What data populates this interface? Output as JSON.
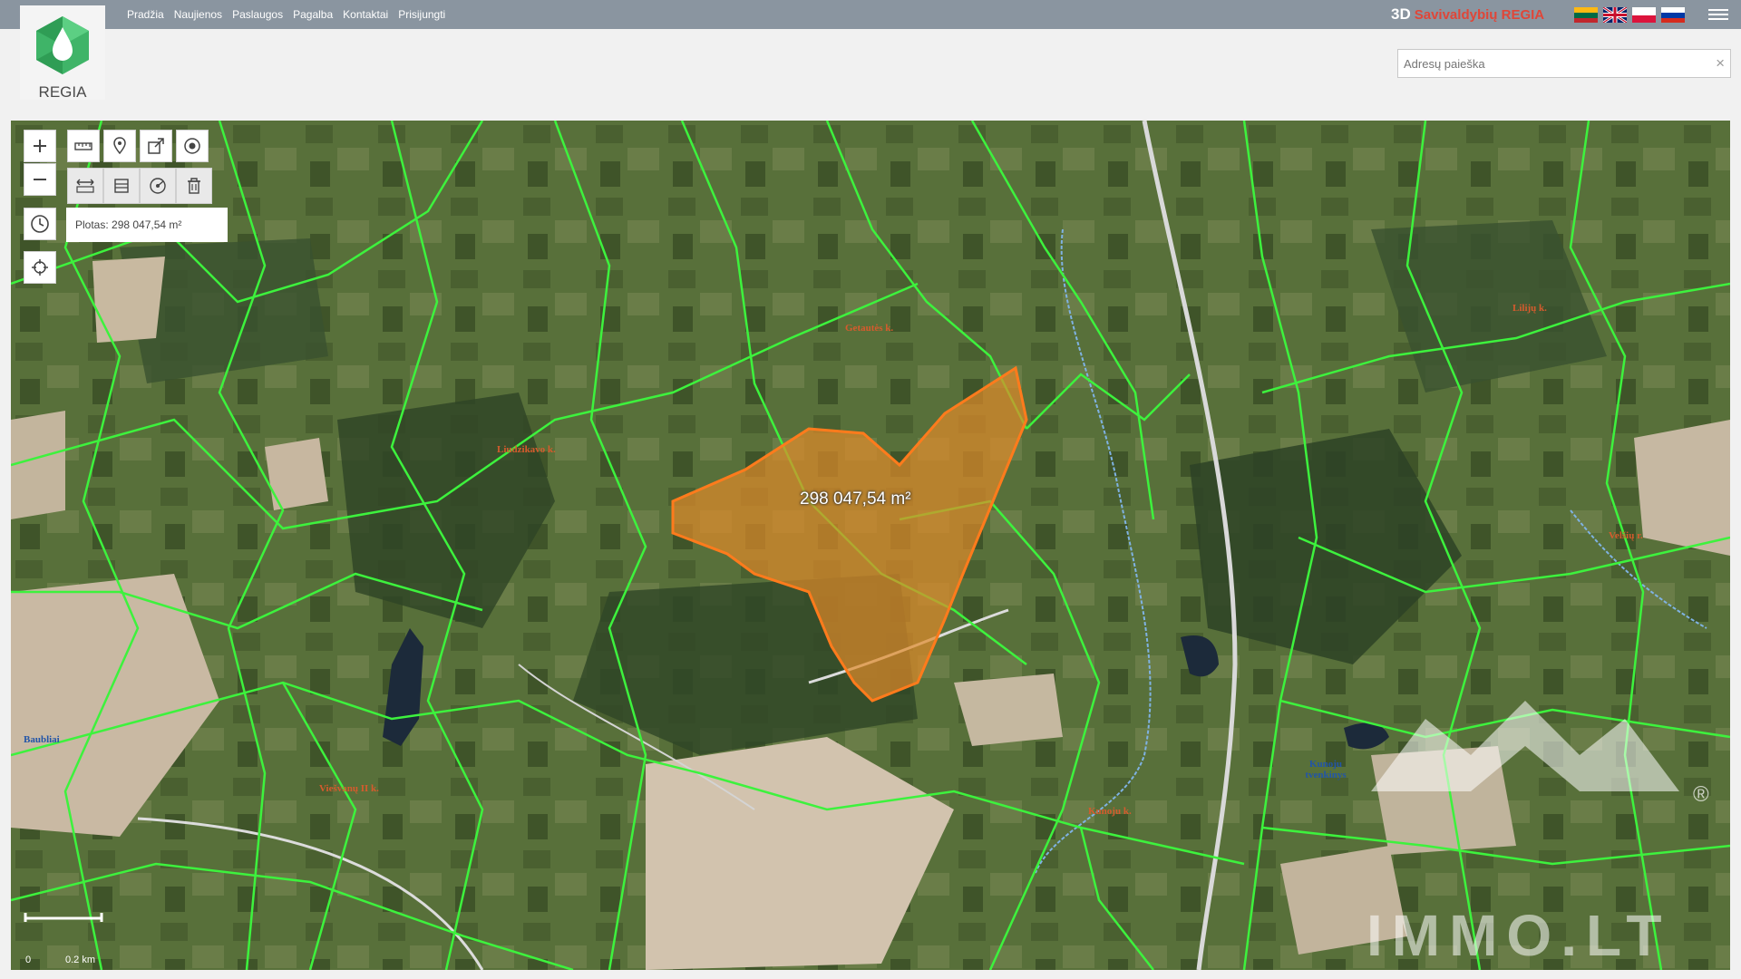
{
  "app": {
    "logo_text": "REGIA",
    "nav": [
      "Pradžia",
      "Naujienos",
      "Paslaugos",
      "Pagalba",
      "Kontaktai",
      "Prisijungti"
    ],
    "brand_3d": "3D",
    "brand_name": "Savivaldybių REGIA",
    "languages": [
      "lt",
      "en",
      "pl",
      "ru"
    ],
    "search_placeholder": "Adresų paieška",
    "search_value": "",
    "clear_icon": "×"
  },
  "map": {
    "area_label": "Plotas: 298 047,54 m²",
    "parcel_label": "298 047,54 m²",
    "parcel_color": "#e08a2a",
    "boundary_color": "#3df23d",
    "places": [
      {
        "id": "getautas",
        "text": "Getautės k."
      },
      {
        "id": "liudzikava",
        "text": "Liudzikavo k."
      },
      {
        "id": "liliju",
        "text": "Lilijų k."
      },
      {
        "id": "velsiu",
        "text": "Velšių r."
      },
      {
        "id": "viesvanu",
        "text": "Viešvanų II k."
      },
      {
        "id": "kunoju",
        "text": "Kunoju k."
      },
      {
        "id": "kunoju-tvenkinys",
        "text": "Kunoju tvenkinys"
      },
      {
        "id": "baubliai",
        "text": "Baubliai"
      }
    ],
    "scale_labels": [
      "0",
      "0.2 km"
    ],
    "watermark": "IMMO.LT",
    "watermark_registered": "®"
  }
}
